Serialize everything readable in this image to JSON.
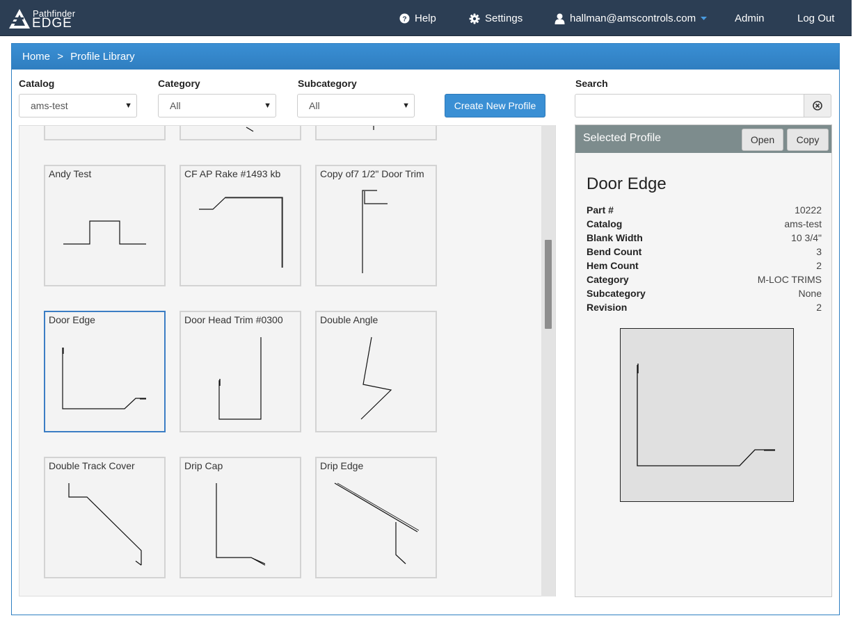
{
  "nav": {
    "brand_top": "Pathfinder",
    "brand_bottom": "EDGE",
    "help": "Help",
    "settings": "Settings",
    "user": "hallman@amscontrols.com",
    "admin": "Admin",
    "logout": "Log Out"
  },
  "breadcrumb": {
    "home": "Home",
    "separator": ">",
    "current": "Profile Library"
  },
  "filters": {
    "catalog_label": "Catalog",
    "catalog_value": "ams-test",
    "category_label": "Category",
    "category_value": "All",
    "subcategory_label": "Subcategory",
    "subcategory_value": "All",
    "create_button": "Create New Profile",
    "search_label": "Search",
    "search_value": ""
  },
  "cards": [
    {
      "title": "",
      "icon": "profile-shape"
    },
    {
      "title": "",
      "icon": "profile-shape"
    },
    {
      "title": "",
      "icon": "profile-shape"
    },
    {
      "title": "Andy Test",
      "icon": "profile-shape"
    },
    {
      "title": "CF AP Rake #1493 kb",
      "icon": "profile-shape"
    },
    {
      "title": "Copy of7 1/2\" Door Trim",
      "icon": "profile-shape"
    },
    {
      "title": "Door Edge",
      "icon": "profile-shape",
      "selected": true
    },
    {
      "title": "Door Head Trim #0300",
      "icon": "profile-shape"
    },
    {
      "title": "Double Angle",
      "icon": "profile-shape"
    },
    {
      "title": "Double Track Cover",
      "icon": "profile-shape"
    },
    {
      "title": "Drip Cap",
      "icon": "profile-shape"
    },
    {
      "title": "Drip Edge",
      "icon": "profile-shape"
    }
  ],
  "selected": {
    "header": "Selected Profile",
    "open_button": "Open",
    "copy_button": "Copy",
    "name": "Door Edge",
    "props": [
      {
        "key": "Part #",
        "value": "10222"
      },
      {
        "key": "Catalog",
        "value": "ams-test"
      },
      {
        "key": "Blank Width",
        "value": "10 3/4\""
      },
      {
        "key": "Bend Count",
        "value": "3"
      },
      {
        "key": "Hem Count",
        "value": "2"
      },
      {
        "key": "Category",
        "value": "M-LOC TRIMS"
      },
      {
        "key": "Subcategory",
        "value": "None"
      },
      {
        "key": "Revision",
        "value": "2"
      }
    ]
  },
  "colors": {
    "nav_bg": "#2c3e54",
    "accent": "#3a8fd4",
    "selected_border": "#3b7dc4",
    "sp_header": "#7d8c8d"
  }
}
